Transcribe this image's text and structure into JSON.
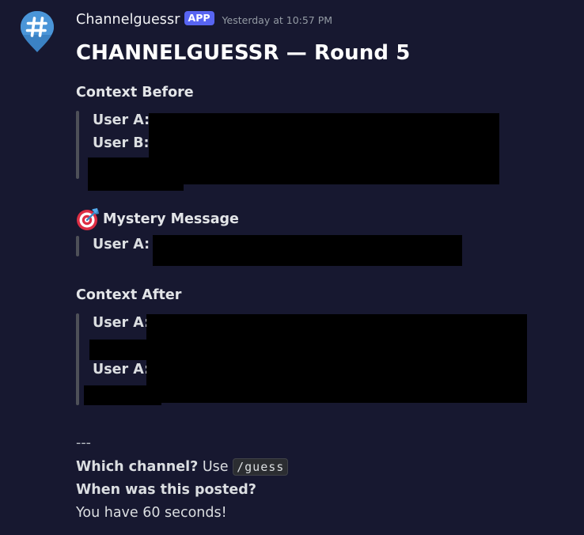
{
  "app": {
    "author": "Channelguessr",
    "badge": "APP",
    "timestamp": "Yesterday at 10:57 PM",
    "avatar_icon": "hashtag-pin-icon",
    "accent_color": "#5865f2"
  },
  "embed": {
    "title": "CHANNELGUESSR — Round 5",
    "context_before": {
      "heading": "Context Before",
      "lines": [
        {
          "label": "User A:"
        },
        {
          "label": "User B:"
        }
      ]
    },
    "mystery": {
      "icon": "direct-hit-target-icon",
      "heading": "Mystery Message",
      "lines": [
        {
          "label": "User A:"
        }
      ]
    },
    "context_after": {
      "heading": "Context After",
      "lines": [
        {
          "label": "User A:"
        },
        {
          "label": "User A:"
        }
      ]
    },
    "footer": {
      "divider": "---",
      "which_channel": "Which channel?",
      "use_text": "Use",
      "command": "/guess",
      "when_posted": "When was this posted?",
      "timer": "You have 60 seconds!"
    }
  }
}
